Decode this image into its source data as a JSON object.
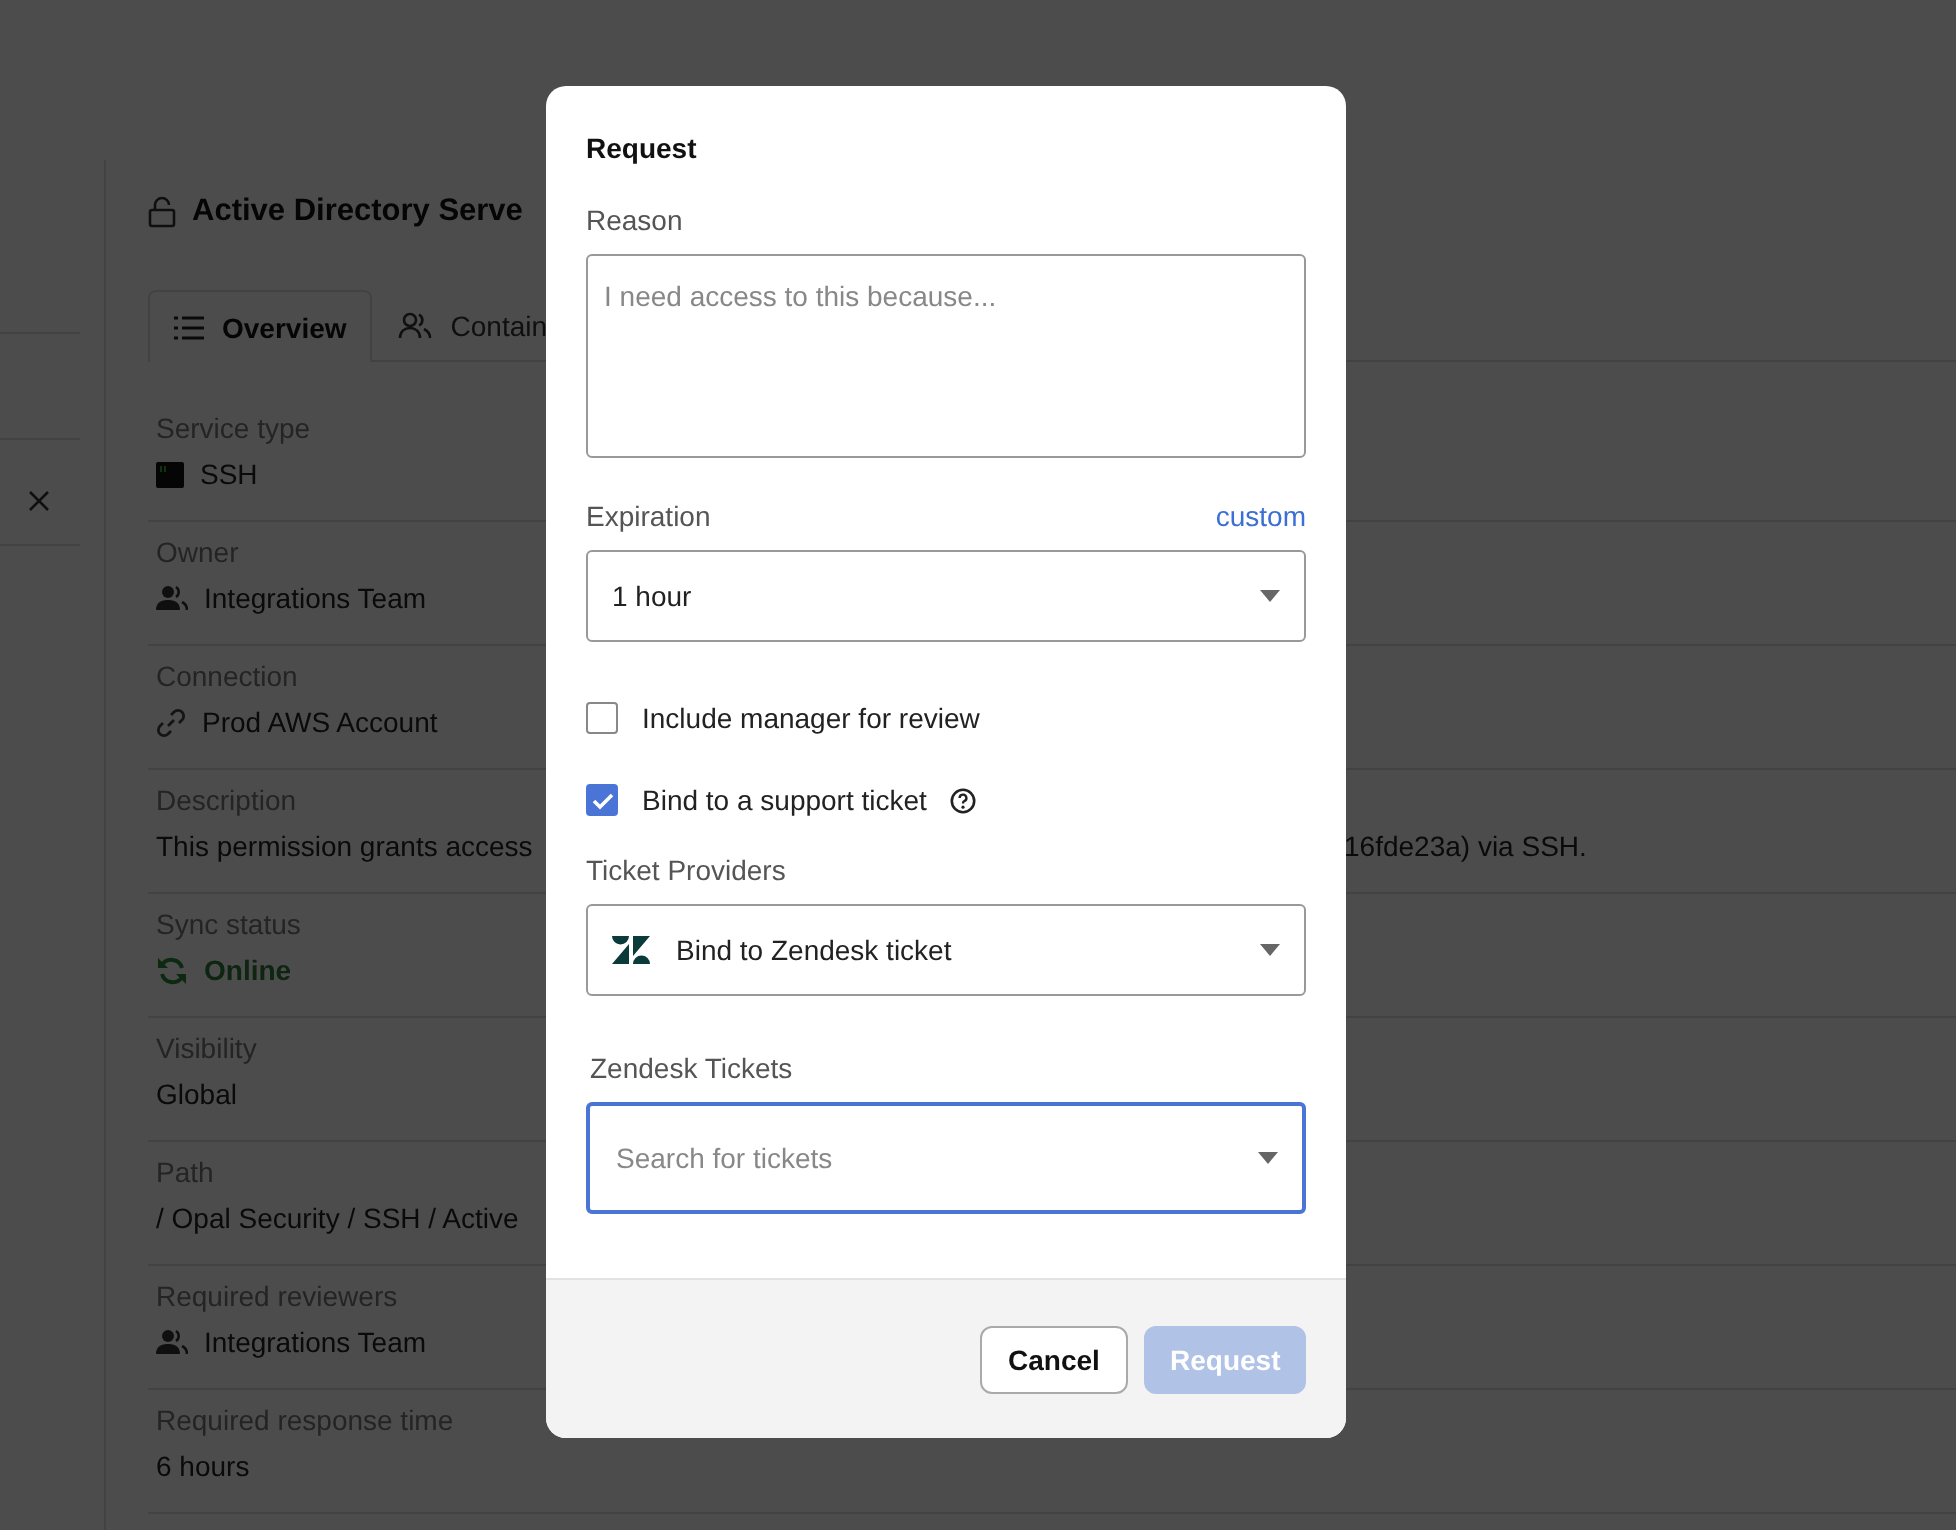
{
  "page": {
    "title": "Active Directory Serve",
    "tabs": [
      {
        "label": "Overview",
        "selected": true,
        "kind": "list"
      },
      {
        "label": "Contain",
        "selected": false,
        "kind": "people"
      }
    ],
    "fields": [
      {
        "label": "Service type",
        "value": "SSH",
        "kind": "terminal"
      },
      {
        "label": "Owner",
        "value": "Integrations Team",
        "kind": "team"
      },
      {
        "label": "Connection",
        "value": "Prod AWS Account",
        "kind": "link"
      },
      {
        "label": "Description",
        "value": "This permission grants access",
        "value_right": "16fde23a) via SSH.",
        "kind": "text"
      },
      {
        "label": "Sync status",
        "value": "Online",
        "kind": "sync"
      },
      {
        "label": "Visibility",
        "value": "Global",
        "kind": "text"
      },
      {
        "label": "Path",
        "value": "/ Opal Security / SSH / Active",
        "kind": "text"
      },
      {
        "label": "Required reviewers",
        "value": "Integrations Team",
        "kind": "team"
      },
      {
        "label": "Required response time",
        "value": "6 hours",
        "kind": "text"
      }
    ]
  },
  "modal": {
    "title": "Request",
    "reason": {
      "label": "Reason",
      "placeholder": "I need access to this because..."
    },
    "expiration": {
      "label": "Expiration",
      "link": "custom",
      "value": "1 hour"
    },
    "checkboxes": [
      {
        "label": "Include manager for review",
        "checked": false,
        "kind": "plain"
      },
      {
        "label": "Bind to a support ticket",
        "checked": true,
        "kind": "help"
      }
    ],
    "ticket_providers": {
      "label": "Ticket Providers",
      "value": "Bind to Zendesk ticket"
    },
    "zendesk_tickets": {
      "label": "Zendesk Tickets",
      "placeholder": "Search for tickets"
    },
    "buttons": [
      {
        "label": "Cancel",
        "kind": "secondary",
        "disabled": false
      },
      {
        "label": "Request",
        "kind": "primary",
        "disabled": true
      }
    ]
  }
}
